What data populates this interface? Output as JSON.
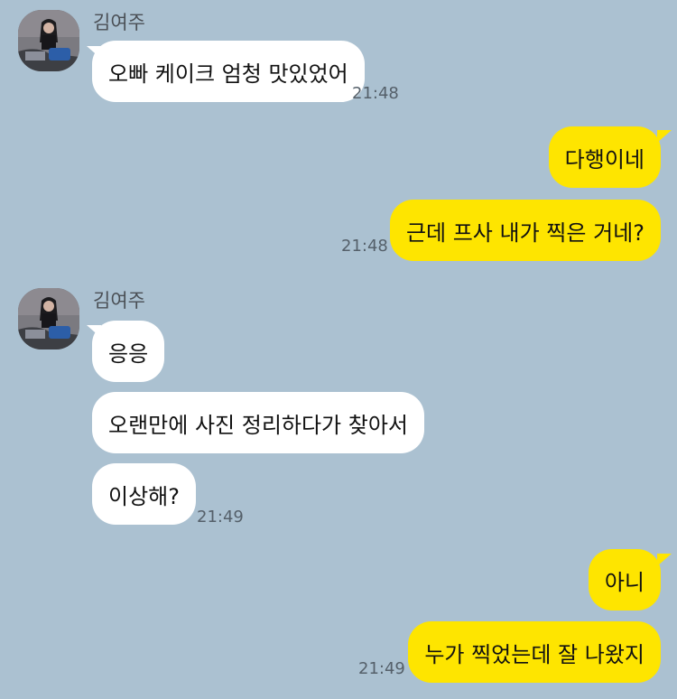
{
  "colors": {
    "background": "#abc1d1",
    "incoming_bubble": "#ffffff",
    "outgoing_bubble": "#fee500",
    "timestamp": "#55606a"
  },
  "messages": [
    {
      "group": 1,
      "sender": "김여주",
      "direction": "incoming",
      "text": "오빠 케이크 엄청 맛있었어",
      "time": "21:48"
    },
    {
      "group": 2,
      "direction": "outgoing",
      "text": "다행이네"
    },
    {
      "group": 2,
      "direction": "outgoing",
      "text": "근데 프사 내가 찍은 거네?",
      "time": "21:48"
    },
    {
      "group": 3,
      "sender": "김여주",
      "direction": "incoming",
      "text": "응응"
    },
    {
      "group": 3,
      "direction": "incoming",
      "text": "오랜만에 사진 정리하다가 찾아서"
    },
    {
      "group": 3,
      "direction": "incoming",
      "text": "이상해?",
      "time": "21:49"
    },
    {
      "group": 4,
      "direction": "outgoing",
      "text": "아니"
    },
    {
      "group": 4,
      "direction": "outgoing",
      "text": "누가 찍었는데 잘 나왔지",
      "time": "21:49"
    }
  ]
}
